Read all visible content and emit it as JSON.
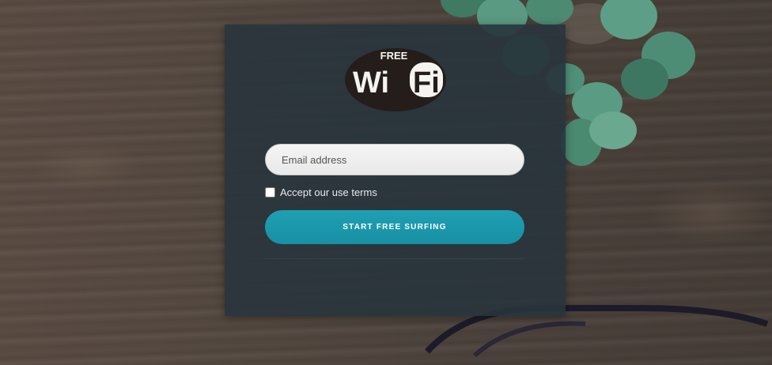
{
  "logo": {
    "top_text": "FREE",
    "main_text": "WiFi"
  },
  "form": {
    "email_placeholder": "Email address",
    "email_value": "",
    "terms_label": "Accept our use terms",
    "terms_checked": false,
    "submit_label": "START FREE SURFING"
  },
  "colors": {
    "card_bg": "#28343c",
    "button_bg": "#1f9fb3",
    "input_bg": "#f0f0f0"
  }
}
